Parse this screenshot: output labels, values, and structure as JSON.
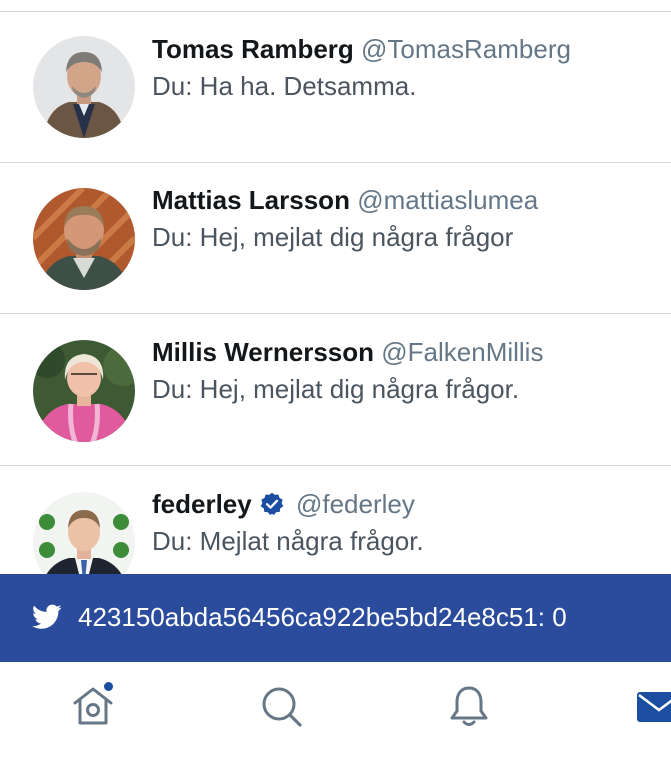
{
  "conversations": [
    {
      "name": "Tomas Ramberg",
      "handle": "@TomasRamberg",
      "verified": false,
      "preview": "Du: Ha ha. Detsamma."
    },
    {
      "name": "Mattias Larsson",
      "handle": "@mattiaslumea",
      "verified": false,
      "preview": "Du: Hej, mejlat dig några frågor"
    },
    {
      "name": "Millis Wernersson",
      "handle": "@FalkenMillis",
      "verified": false,
      "preview": "Du: Hej, mejlat dig några frågor."
    },
    {
      "name": "federley",
      "handle": "@federley",
      "verified": true,
      "preview": "Du: Mejlat några frågor."
    }
  ],
  "banner": {
    "text": "423150abda56456ca922be5bd24e8c51: 0",
    "icon": "twitter-bird-icon"
  },
  "tabbar": {
    "items": [
      "home-icon",
      "search-icon",
      "bell-icon",
      "mail-icon"
    ],
    "home_has_new": true
  },
  "colors": {
    "accent": "#1da1f2",
    "banner": "#2b4b9c",
    "nav": "#1b4ea0",
    "handle": "#657786"
  }
}
